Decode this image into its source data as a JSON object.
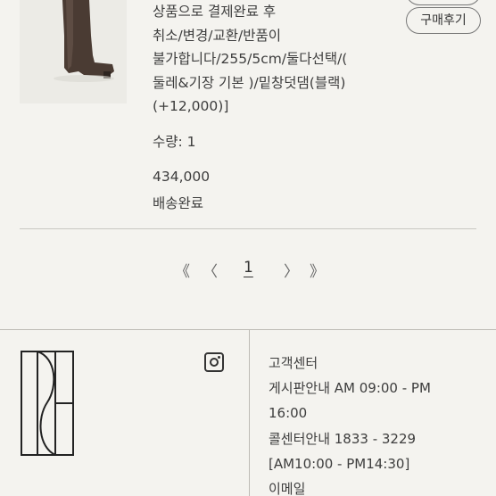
{
  "product": {
    "desc_lines": [
      "상품으로 결제완료 후",
      "취소/변경/교환/반품이",
      "불가합니다/255/5cm/둘다선택/(",
      "둘레&기장 기본 )/밑창덧댐(블랙)",
      "(+12,000)]"
    ],
    "quantity": "수량: 1",
    "price": "434,000",
    "status": "배송완료",
    "review_button": "구매후기"
  },
  "pagination": {
    "first": "《",
    "prev": "〈",
    "current": "1",
    "next": "〉",
    "last": "》"
  },
  "footer": {
    "icons": {
      "logo": "brand-logo",
      "instagram": "instagram-icon"
    },
    "customer_center": [
      "고객센터",
      "게시판안내 AM 09:00 - PM",
      "16:00",
      "콜센터안내 1833 - 3229",
      "[AM10:00 - PM14:30]",
      "이메일"
    ]
  }
}
